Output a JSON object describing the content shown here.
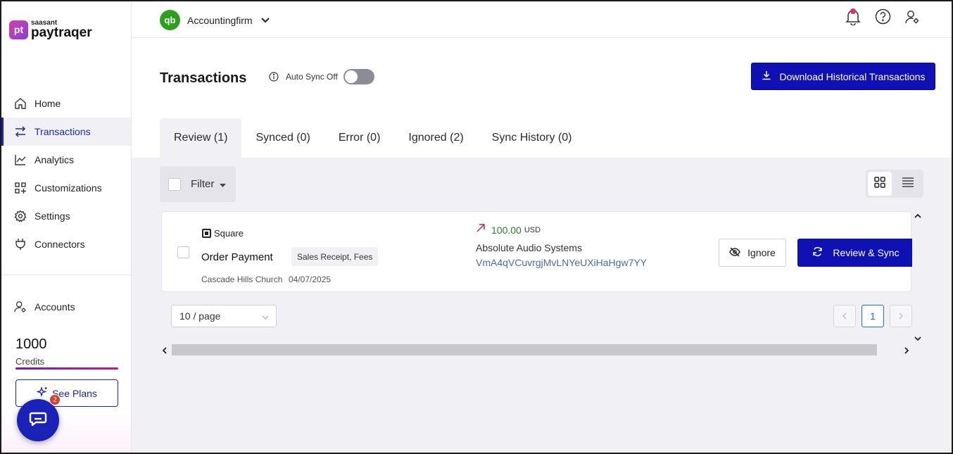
{
  "brand": {
    "small": "saasant",
    "name": "paytraqer",
    "badge": "pt"
  },
  "nav": {
    "items": [
      {
        "label": "Home",
        "icon": "home-icon"
      },
      {
        "label": "Transactions",
        "icon": "transfer-arrows-icon"
      },
      {
        "label": "Analytics",
        "icon": "line-chart-icon"
      },
      {
        "label": "Customizations",
        "icon": "grid-plus-icon"
      },
      {
        "label": "Settings",
        "icon": "gear-icon"
      },
      {
        "label": "Connectors",
        "icon": "plug-icon"
      }
    ],
    "accounts": "Accounts"
  },
  "credits": {
    "value": "1000",
    "label": "Credits"
  },
  "see_plans": "See Plans",
  "chat": {
    "badge": "2"
  },
  "header": {
    "company_logo": "qb",
    "company": "Accountingfirm"
  },
  "page": {
    "title": "Transactions",
    "auto_sync": "Auto Sync Off",
    "download_btn": "Download Historical Transactions"
  },
  "tabs": [
    {
      "label": "Review (1)",
      "active": true
    },
    {
      "label": "Synced (0)"
    },
    {
      "label": "Error (0)"
    },
    {
      "label": "Ignored (2)"
    },
    {
      "label": "Sync History (0)"
    }
  ],
  "filter": {
    "label": "Filter"
  },
  "transaction": {
    "source": "Square",
    "title": "Order Payment",
    "tag": "Sales Receipt, Fees",
    "customer": "Cascade Hills Church",
    "date": "04/07/2025",
    "amount": "100.00",
    "currency": "USD",
    "payer": "Absolute Audio Systems",
    "id": "VmA4qVCuvrgjMvLNYeUXiHaHgw7YY",
    "ignore_btn": "Ignore",
    "review_btn": "Review & Sync"
  },
  "pagination": {
    "page_size": "10 / page",
    "current_page": "1"
  },
  "colors": {
    "primary": "#1011b4",
    "amount": "#2e7d32",
    "brand_gradient": [
      "#d03fae",
      "#8b3fd6"
    ]
  }
}
